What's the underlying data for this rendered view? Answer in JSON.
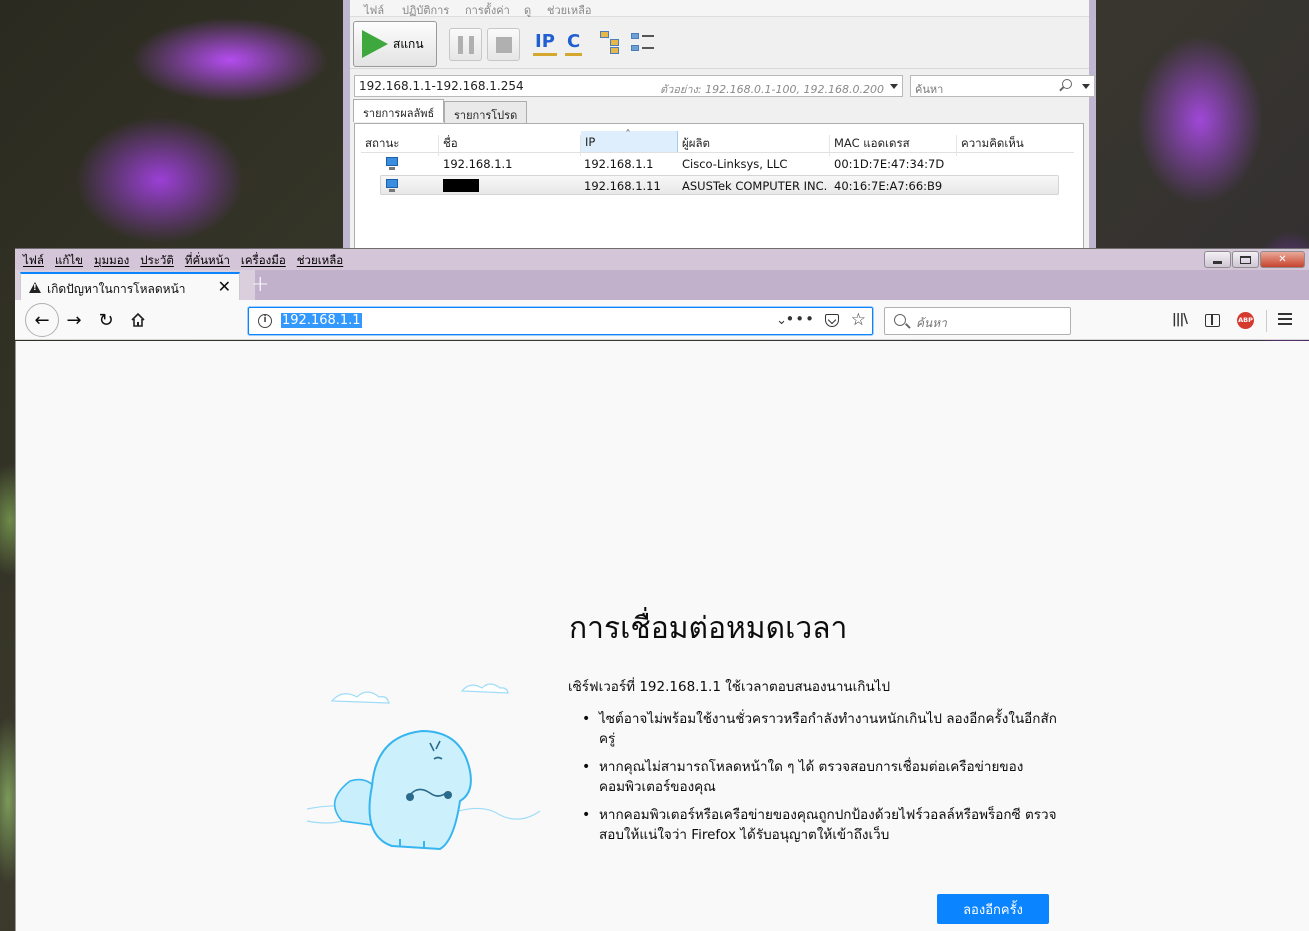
{
  "scanner": {
    "menu": [
      "ไฟล์",
      "ปฏิบัติการ",
      "การตั้งค่า",
      "ดู",
      "ช่วยเหลือ"
    ],
    "scan_label": "สแกน",
    "ip_btn": "IP",
    "c_btn": "C",
    "ip_range": "192.168.1.1-192.168.1.254",
    "ip_hint": "ตัวอย่าง: 192.168.0.1-100, 192.168.0.200",
    "search_placeholder": "ค้นหา",
    "tabs": [
      "รายการผลลัพธ์",
      "รายการโปรด"
    ],
    "columns": [
      "สถานะ",
      "ชื่อ",
      "IP",
      "ผู้ผลิต",
      "MAC แอดเดรส",
      "ความคิดเห็น"
    ],
    "rows": [
      {
        "name": "192.168.1.1",
        "ip": "192.168.1.1",
        "vendor": "Cisco-Linksys, LLC",
        "mac": "00:1D:7E:47:34:7D",
        "comment": ""
      },
      {
        "name": "",
        "ip": "192.168.1.11",
        "vendor": "ASUSTek COMPUTER INC.",
        "mac": "40:16:7E:A7:66:B9",
        "comment": ""
      }
    ]
  },
  "firefox": {
    "menu": [
      "ไฟล์",
      "แก้ไข",
      "มุมมอง",
      "ประวัติ",
      "ที่คั่นหน้า",
      "เครื่องมือ",
      "ช่วยเหลือ"
    ],
    "tab_title": "เกิดปัญหาในการโหลดหน้า",
    "url": "192.168.1.1",
    "search_placeholder": "ค้นหา",
    "abp_label": "ABP",
    "error": {
      "title": "การเชื่อมต่อหมดเวลา",
      "description": "เซิร์ฟเวอร์ที่ 192.168.1.1 ใช้เวลาตอบสนองนานเกินไป",
      "bullets": [
        "ไซต์อาจไม่พร้อมใช้งานชั่วคราวหรือกำลังทำงานหนักเกินไป ลองอีกครั้งในอีกสักครู่",
        "หากคุณไม่สามารถโหลดหน้าใด ๆ ได้ ตรวจสอบการเชื่อมต่อเครือข่ายของคอมพิวเตอร์ของคุณ",
        "หากคอมพิวเตอร์หรือเครือข่ายของคุณถูกปกป้องด้วยไฟร์วอลล์หรือพร็อกซี ตรวจสอบให้แน่ใจว่า Firefox ได้รับอนุญาตให้เข้าถึงเว็บ"
      ],
      "retry_label": "ลองอีกครั้ง"
    }
  }
}
